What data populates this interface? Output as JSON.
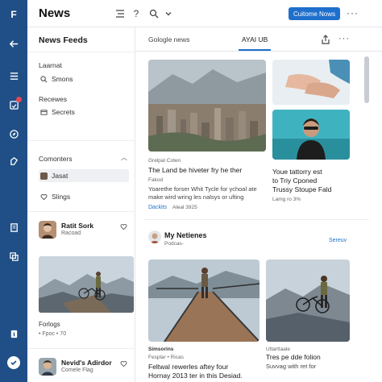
{
  "app": {
    "logo_letter": "F",
    "title": "News"
  },
  "header": {
    "primary_button": "Cuitome Nows",
    "more": "···"
  },
  "rail": {
    "icons": [
      "back-arrow-icon",
      "menu-icon",
      "inbox-icon",
      "compass-icon",
      "tag-icon",
      "document-icon",
      "layers-icon",
      "info-icon",
      "user-icon"
    ],
    "notification_color": "#e5484d"
  },
  "sidebar": {
    "title": "News Feeds",
    "section1_label": "Laarnat",
    "search_item": "Smons",
    "section2_label": "Recewes",
    "secrets_item": "Secrets",
    "section3_label": "Comonters",
    "active_item": "Jasat",
    "likes_item": "Slings",
    "person1": {
      "name": "Ratit Sork",
      "sub": "Racoad"
    },
    "photo_caption": "Forlogs",
    "photo_sub": "• Fpoc • 70",
    "person2": {
      "name": "Nevid's Adirdor",
      "sub": "Comele Flag"
    }
  },
  "tabs": [
    "Gologle news",
    "AYAI UB"
  ],
  "tabbar": {
    "more": "···"
  },
  "cards": [
    {
      "meta": "Grelpal Coten",
      "headline": "The Land be hiveter fry he ther",
      "meta2": "Fakod",
      "desc": [
        "Yoarethe forser Whit Tycle for ychoal ate",
        "make wird wring les nalsys or ufting"
      ],
      "link": "Dackits",
      "date": "Aleal 3925"
    },
    {
      "headline": [
        "Youe tattorry est",
        "to Triy Cponed",
        "Trussy Stoupe Fald"
      ],
      "meta": "Lamg ro 3%"
    }
  ],
  "section": {
    "title": "My Netienes",
    "sub": "Podcas-",
    "link": "Sereuv"
  },
  "bottom_cards": [
    {
      "meta": "Simsorins",
      "meta2": "Fesplar • Ricas",
      "headline": [
        "Feltwal rewerles aftey four",
        "Hornay 2013 ter in this Desiad."
      ]
    },
    {
      "meta": "Uttarttaale",
      "headline": [
        "Tres pe dde folion",
        "Suvvag with ret for"
      ]
    }
  ],
  "colors": {
    "rail": "#1f4f86",
    "accent": "#1f6fcc"
  }
}
